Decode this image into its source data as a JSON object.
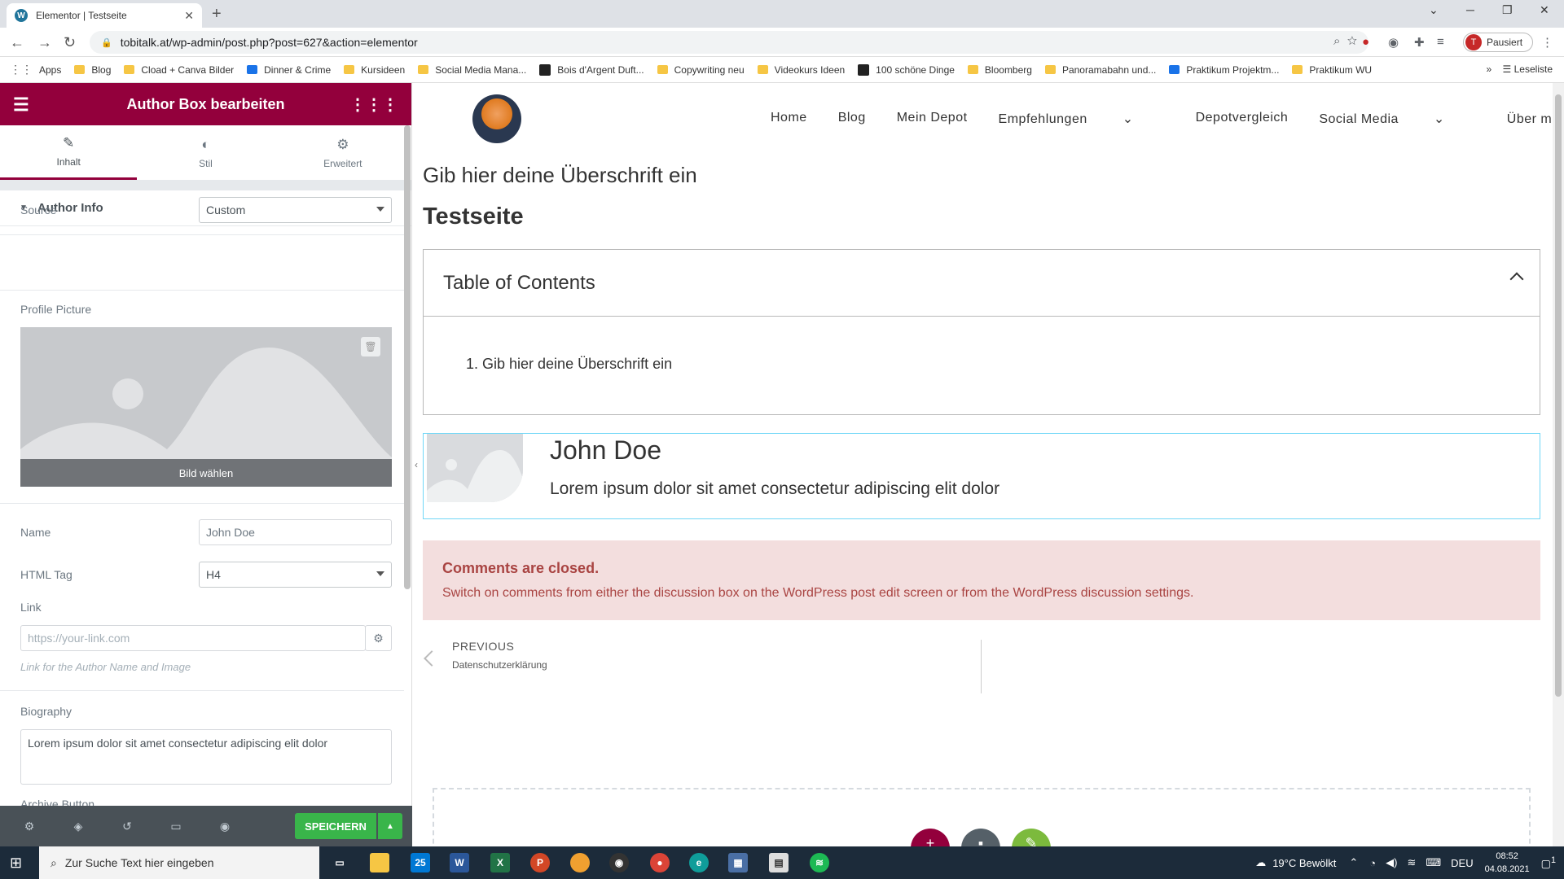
{
  "browser": {
    "tab_title": "Elementor | Testseite",
    "url": "tobitalk.at/wp-admin/post.php?post=627&action=elementor",
    "profile_label": "Pausiert",
    "profile_initial": "T",
    "bookmarks": [
      {
        "label": "Apps",
        "icon": "apps-icon"
      },
      {
        "label": "Blog",
        "icon": "folder-icon"
      },
      {
        "label": "Cload + Canva Bilder",
        "icon": "folder-icon"
      },
      {
        "label": "Dinner & Crime",
        "icon": "site-icon"
      },
      {
        "label": "Kursideen",
        "icon": "folder-icon"
      },
      {
        "label": "Social Media Mana...",
        "icon": "folder-icon"
      },
      {
        "label": "Bois d'Argent Duft...",
        "icon": "site-icon"
      },
      {
        "label": "Copywriting neu",
        "icon": "folder-icon"
      },
      {
        "label": "Videokurs Ideen",
        "icon": "folder-icon"
      },
      {
        "label": "100 schöne Dinge",
        "icon": "site-icon"
      },
      {
        "label": "Bloomberg",
        "icon": "folder-icon"
      },
      {
        "label": "Panoramabahn und...",
        "icon": "folder-icon"
      },
      {
        "label": "Praktikum Projektm...",
        "icon": "site-icon"
      },
      {
        "label": "Praktikum WU",
        "icon": "folder-icon"
      }
    ],
    "reading_list": "Leseliste"
  },
  "panel": {
    "title": "Author Box bearbeiten",
    "tabs": [
      {
        "label": "Inhalt",
        "icon": "pencil-icon"
      },
      {
        "label": "Stil",
        "icon": "contrast-icon"
      },
      {
        "label": "Erweitert",
        "icon": "gear-icon"
      }
    ],
    "section_title": "Author Info",
    "source_label": "Source",
    "source_value": "Custom",
    "profile_picture_label": "Profile Picture",
    "choose_image": "Bild wählen",
    "name_label": "Name",
    "name_value": "John Doe",
    "html_tag_label": "HTML Tag",
    "html_tag_value": "H4",
    "link_label": "Link",
    "link_placeholder": "https://your-link.com",
    "link_help": "Link for the Author Name and Image",
    "biography_label": "Biography",
    "biography_value": "Lorem ipsum dolor sit amet consectetur adipiscing elit dolor",
    "archive_button_label": "Archive Button",
    "save_label": "SPEICHERN"
  },
  "preview": {
    "nav": [
      "Home",
      "Blog",
      "Mein Depot",
      "Empfehlungen",
      "Depotvergleich",
      "Social Media",
      "Über mich"
    ],
    "heading_sub": "Gib hier deine Überschrift ein",
    "heading_main": "Testseite",
    "toc_title": "Table of Contents",
    "toc_items": [
      "1.  Gib hier deine Überschrift ein"
    ],
    "author_name": "John Doe",
    "author_bio": "Lorem ipsum dolor sit amet consectetur adipiscing elit dolor",
    "comments_title": "Comments are closed.",
    "comments_text": "Switch on comments from either the discussion box on the WordPress post edit screen or from the WordPress discussion settings.",
    "prev_label": "PREVIOUS",
    "prev_title": "Datenschutzerklärung"
  },
  "taskbar": {
    "search_placeholder": "Zur Suche Text hier eingeben",
    "mail_badge": "25",
    "weather": "19°C  Bewölkt",
    "language": "DEU",
    "time": "08:52",
    "date": "04.08.2021",
    "notification_count": "1"
  },
  "colors": {
    "elementor_brand": "#93003c",
    "save_green": "#39b54a",
    "comments_bg": "#f3dede",
    "comments_text": "#a94442",
    "author_box_border": "#71d7f7"
  }
}
